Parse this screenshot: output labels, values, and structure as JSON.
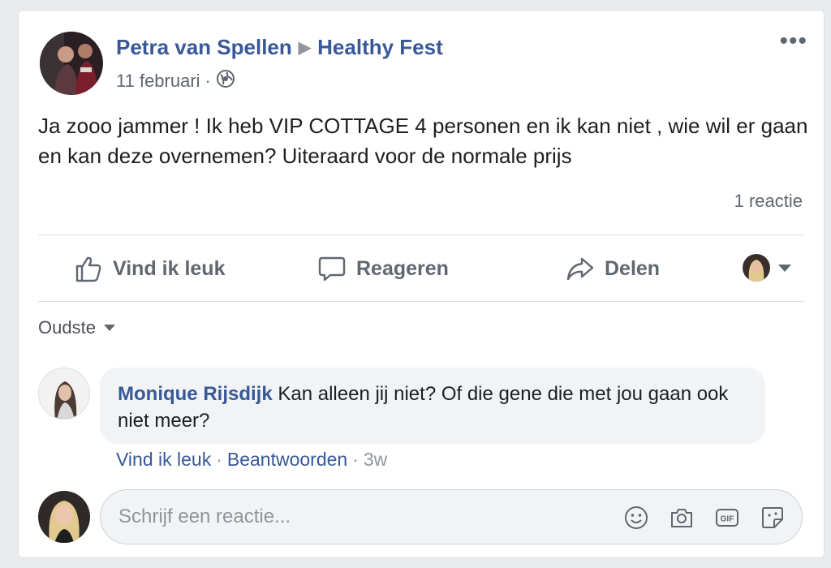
{
  "post": {
    "author": "Petra van Spellen",
    "group": "Healthy Fest",
    "date": "11 februari",
    "date_separator": "·",
    "text": "Ja zooo jammer ! Ik heb VIP COTTAGE 4 personen en ik kan niet , wie wil er gaan en kan deze overnemen? Uiteraard voor de normale prijs",
    "comment_count": "1 reactie",
    "more_label": "•••",
    "privacy_icon": "globe-icon"
  },
  "actions": {
    "like": "Vind ik leuk",
    "comment": "Reageren",
    "share": "Delen"
  },
  "sort": {
    "label": "Oudste"
  },
  "comment": {
    "author": "Monique Rijsdijk",
    "text": "Kan alleen jij niet? Of die gene die met jou gaan ook niet meer?",
    "like": "Vind ik leuk",
    "reply": "Beantwoorden",
    "time": "3w",
    "separator": "·"
  },
  "composer": {
    "placeholder": "Schrijf een reactie...",
    "tools": [
      "emoji-icon",
      "camera-icon",
      "gif-icon",
      "sticker-icon"
    ],
    "gif_label": "GIF"
  },
  "colors": {
    "link": "#385898",
    "secondary_text": "#606770",
    "background": "#e9ebee"
  }
}
